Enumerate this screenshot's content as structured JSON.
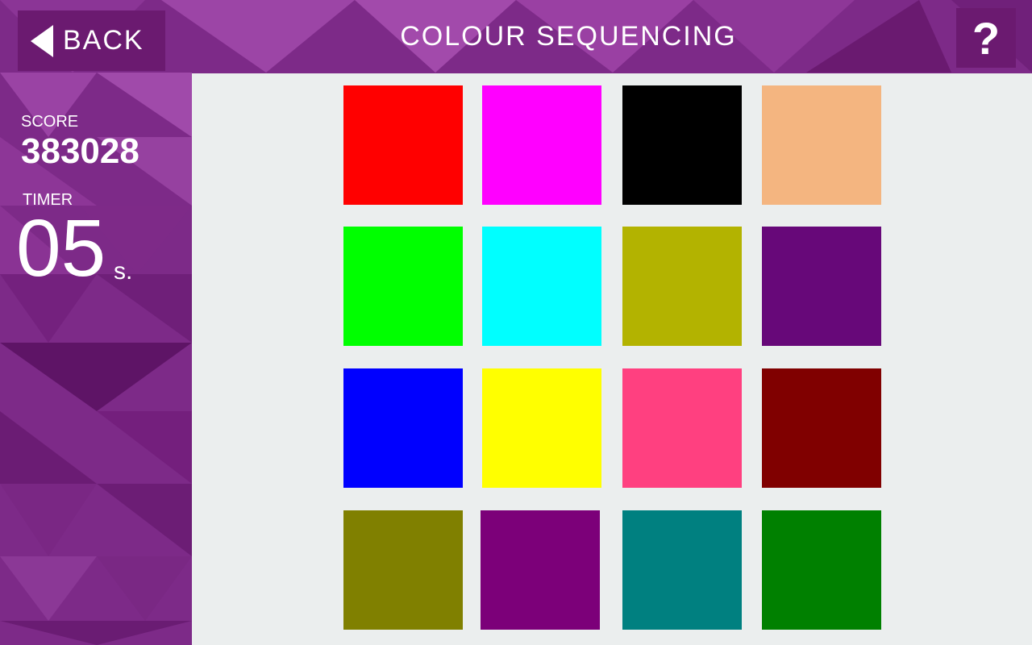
{
  "header": {
    "back_label": "BACK",
    "title": "COLOUR SEQUENCING",
    "help_label": "?"
  },
  "stats": {
    "score_label": "SCORE",
    "score_value": "383028",
    "timer_label": "TIMER",
    "timer_value": "05",
    "timer_unit": "s."
  },
  "colors": {
    "panel_dark": "#6b1a70",
    "board_bg": "#ebeeee"
  },
  "tiles": [
    {
      "color": "#ff0000"
    },
    {
      "color": "#ff00ff"
    },
    {
      "color": "#000000"
    },
    {
      "color": "#f4b580"
    },
    {
      "color": "#00ff00"
    },
    {
      "color": "#00ffff"
    },
    {
      "color": "#b3b300"
    },
    {
      "color": "#670879"
    },
    {
      "color": "#0000ff"
    },
    {
      "color": "#ffff00"
    },
    {
      "color": "#ff4080"
    },
    {
      "color": "#800000"
    },
    {
      "color": "#808000"
    },
    {
      "color": "#7c0079"
    },
    {
      "color": "#008080"
    },
    {
      "color": "#008000"
    }
  ]
}
